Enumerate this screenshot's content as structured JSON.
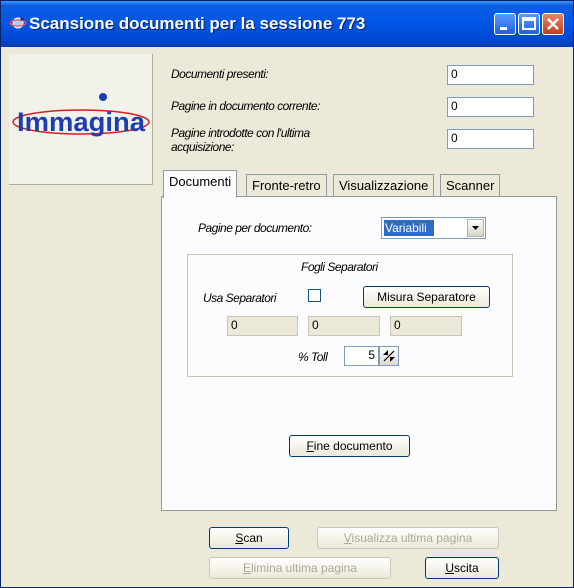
{
  "window": {
    "title": "Scansione documenti per la sessione 773"
  },
  "logo": {
    "text": "Immagina"
  },
  "info": {
    "documenti_presenti_label": "Documenti presenti:",
    "documenti_presenti_value": "0",
    "pagine_documento_label": "Pagine in documento corrente:",
    "pagine_documento_value": "0",
    "pagine_acquisizione_label_1": "Pagine introdotte con l'ultima",
    "pagine_acquisizione_label_2": "acquisizione:",
    "pagine_acquisizione_value": "0"
  },
  "tabs": [
    {
      "label": "Documenti"
    },
    {
      "label": "Fronte-retro"
    },
    {
      "label": "Visualizzazione"
    },
    {
      "label": "Scanner"
    }
  ],
  "documenti_tab": {
    "pagine_per_documento_label": "Pagine per documento:",
    "pagine_per_documento_value": "Variabili",
    "group_title": "Fogli Separatori",
    "usa_separatori_label": "Usa Separatori",
    "usa_separatori_checked": false,
    "misura_separatore_label": "Misura Separatore",
    "separator_values": [
      "0",
      "0",
      "0"
    ],
    "toll_label": "% Toll",
    "toll_value": "5",
    "fine_documento_first": "F",
    "fine_documento_rest": "ine documento"
  },
  "buttons": {
    "scan_first": "S",
    "scan_rest": "can",
    "visualizza_first": "V",
    "visualizza_rest": "isualizza ultima pagina",
    "elimina_first": "E",
    "elimina_rest": "limina ultima pagina",
    "uscita_first": "U",
    "uscita_rest": "scita"
  },
  "colors": {
    "titlebar": "#0055e5",
    "window_bg": "#ece9d8",
    "logo_text": "#1a3fb0",
    "logo_ellipse": "#d42020"
  }
}
